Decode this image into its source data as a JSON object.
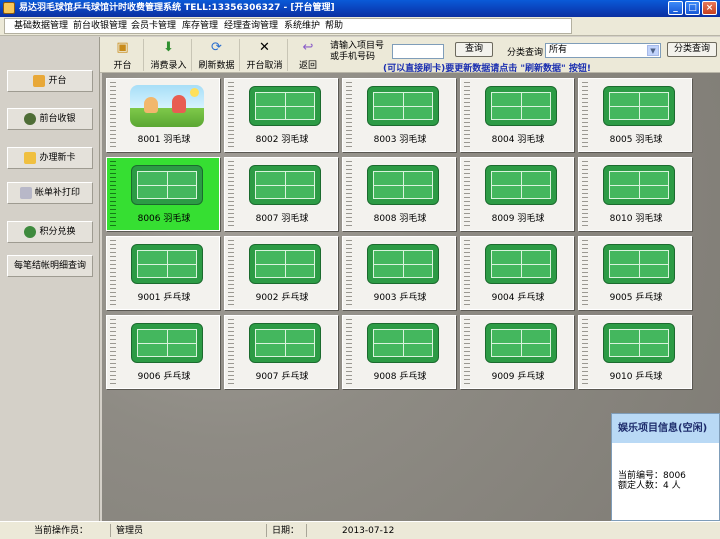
{
  "window": {
    "title": "易达羽毛球馆乒乓球馆计时收费管理系统 TELL:13356306327 - [开台管理]",
    "controls": [
      "minimize",
      "maximize",
      "close"
    ]
  },
  "menu": {
    "items": [
      "基础数据管理",
      "前台收银管理",
      "会员卡管理",
      "库存管理",
      "经理查询管理",
      "系统维护",
      "帮助"
    ]
  },
  "toolbar": {
    "buttons": [
      {
        "label": "开台",
        "icon": "open-table-icon"
      },
      {
        "label": "消费录入",
        "icon": "consume-entry-icon"
      },
      {
        "label": "刷新数据",
        "icon": "refresh-icon"
      },
      {
        "label": "开台取消",
        "icon": "cancel-icon"
      },
      {
        "label": "返回",
        "icon": "return-icon"
      }
    ],
    "search_label": "请输入项目号\n或手机号码",
    "search_value": "",
    "search_button": "查询",
    "category_label": "分类查询",
    "category_value": "所有",
    "category_button": "分类查询",
    "hint": "(可以直接刷卡)要更新数据请点击 \"刷新数据\" 按钮!"
  },
  "sidebar": {
    "buttons": [
      "开台",
      "前台收银",
      "办理新卡",
      "帐单补打印",
      "积分兑换",
      "每笔结帐明细查询"
    ]
  },
  "tiles": [
    {
      "label": "8001 羽毛球",
      "photo": true
    },
    {
      "label": "8002 羽毛球"
    },
    {
      "label": "8003 羽毛球"
    },
    {
      "label": "8004 羽毛球"
    },
    {
      "label": "8005 羽毛球"
    },
    {
      "label": "8006 羽毛球",
      "active": true
    },
    {
      "label": "8007 羽毛球"
    },
    {
      "label": "8008 羽毛球"
    },
    {
      "label": "8009 羽毛球"
    },
    {
      "label": "8010 羽毛球"
    },
    {
      "label": "9001 乒乓球"
    },
    {
      "label": "9002 乒乓球"
    },
    {
      "label": "9003 乒乓球"
    },
    {
      "label": "9004 乒乓球"
    },
    {
      "label": "9005 乒乓球"
    },
    {
      "label": "9006 乒乓球"
    },
    {
      "label": "9007 乒乓球"
    },
    {
      "label": "9008 乒乓球"
    },
    {
      "label": "9009 乒乓球"
    },
    {
      "label": "9010 乒乓球"
    }
  ],
  "info": {
    "title": "娱乐项目信息(空闲)",
    "number_label": "当前编号：8006",
    "capacity_label": "额定人数：4 人"
  },
  "status": {
    "operator_label": "当前操作员：",
    "operator": "管理员",
    "date_label": "日期：",
    "date": "2013-07-12"
  }
}
